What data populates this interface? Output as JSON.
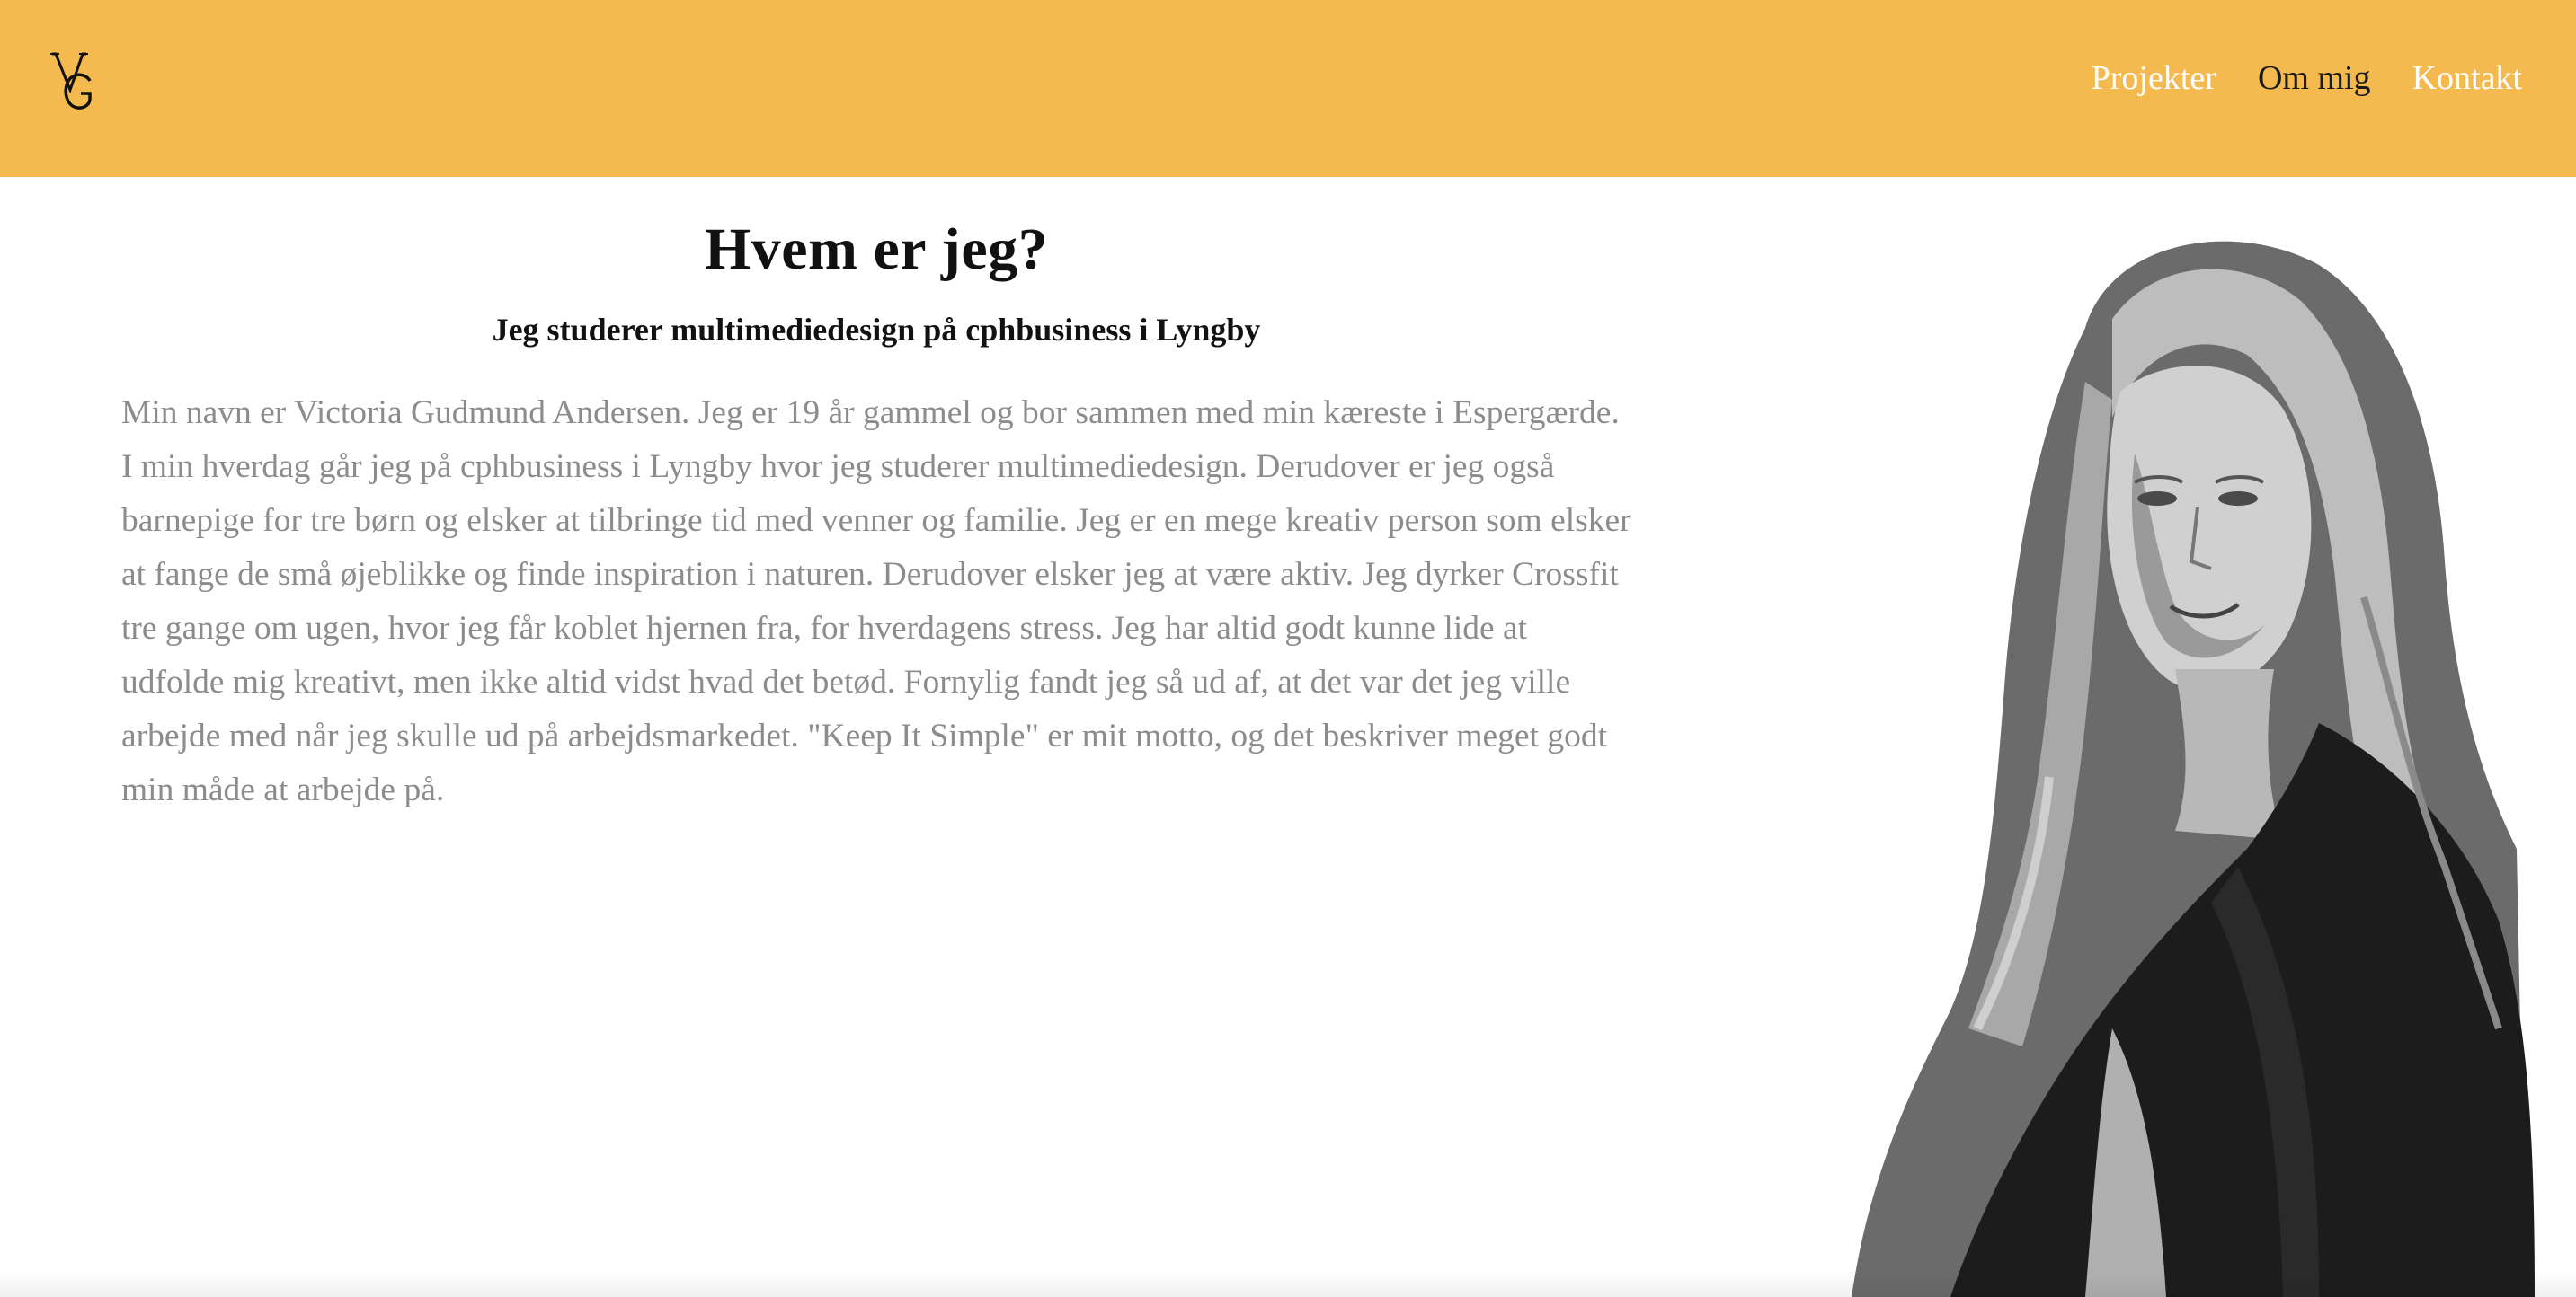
{
  "header": {
    "logo_icon": "vg-monogram-logo",
    "nav": [
      {
        "label": "Projekter",
        "active": false
      },
      {
        "label": "Om mig",
        "active": true
      },
      {
        "label": "Kontakt",
        "active": false
      }
    ]
  },
  "main": {
    "title": "Hvem er jeg?",
    "subtitle": "Jeg studerer multimediedesign på cphbusiness i Lyngby",
    "body": "Min navn er Victoria Gudmund Andersen. Jeg er 19 år gammel og bor sammen med min kæreste i Espergærde. I min hverdag går jeg på cphbusiness i Lyngby hvor jeg studerer multimediedesign. Derudover er jeg også barnepige for tre børn og elsker at tilbringe tid med venner og familie. Jeg er en mege kreativ person som elsker at fange de små øjeblikke og finde inspiration i naturen. Derudover elsker jeg at være aktiv. Jeg dyrker Crossfit tre gange om ugen, hvor jeg får koblet hjernen fra, for hverdagens stress. Jeg har altid godt kunne lide at udfolde mig kreativt, men ikke altid vidst hvad det betød. Fornylig fandt jeg så ud af, at det var det jeg ville arbejde med når jeg skulle ud på arbejdsmarkedet. \"Keep It Simple\" er mit motto, og det beskriver meget godt min måde at arbejde på."
  },
  "colors": {
    "header_bg": "#f4b94f",
    "nav_text": "#ffffff",
    "nav_active": "#1a1a1a",
    "body_text": "#8c8c8c",
    "heading": "#111111"
  },
  "portrait_icon": "portrait-photo"
}
